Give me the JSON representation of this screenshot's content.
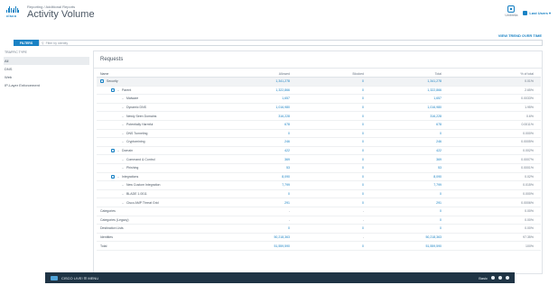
{
  "header": {
    "logo_text": "cisco",
    "breadcrumb": "Reporting / Additional Reports",
    "title": "Activity Volume",
    "shield_label": "Umbrella",
    "user_label": "Last Users ▾"
  },
  "trend_link": "VIEW TREND OVER TIME",
  "filter": {
    "button_label": "FILTERS",
    "placeholder": "Filter by identity"
  },
  "sidebar": {
    "heading": "TRAFFIC TYPE",
    "items": [
      {
        "label": "All",
        "active": true
      },
      {
        "label": "DNS",
        "active": false
      },
      {
        "label": "Web",
        "active": false
      },
      {
        "label": "IP-Layer Enforcement",
        "active": false
      }
    ]
  },
  "panel": {
    "title": "Requests"
  },
  "table": {
    "headers": {
      "name": "Name",
      "allowed": "Allowed",
      "blocked": "Blocked",
      "total": "Total",
      "pct": "% of total"
    },
    "rows": [
      {
        "name": "Security",
        "level": 0,
        "check": true,
        "allowed": "1,341,278",
        "blocked": "0",
        "total": "1,341,278",
        "pct": "0.01%",
        "group": true
      },
      {
        "name": "Parent",
        "level": 1,
        "check": true,
        "allowed": "1,322,866",
        "blocked": "0",
        "total": "1,322,866",
        "pct": "2.65%",
        "group": false
      },
      {
        "name": "Malware",
        "level": 2,
        "check": false,
        "allowed": "1,657",
        "blocked": "0",
        "total": "1,657",
        "pct": "0.0033%",
        "group": false
      },
      {
        "name": "Dynamic DNS",
        "level": 2,
        "check": false,
        "allowed": "1,016,980",
        "blocked": "0",
        "total": "1,016,980",
        "pct": "1.95%",
        "group": false
      },
      {
        "name": "Newly Seen Domains",
        "level": 2,
        "check": false,
        "allowed": "316,228",
        "blocked": "0",
        "total": "316,228",
        "pct": "0.6%",
        "group": false
      },
      {
        "name": "Potentially Harmful",
        "level": 2,
        "check": false,
        "allowed": "678",
        "blocked": "0",
        "total": "678",
        "pct": "0.0011%",
        "group": false
      },
      {
        "name": "DNS Tunneling",
        "level": 2,
        "check": false,
        "allowed": "0",
        "blocked": "0",
        "total": "0",
        "pct": "0.000%",
        "group": false
      },
      {
        "name": "Cryptomining",
        "level": 2,
        "check": false,
        "allowed": "246",
        "blocked": "0",
        "total": "246",
        "pct": "0.0005%",
        "group": false
      },
      {
        "name": "Domain",
        "level": 1,
        "check": true,
        "allowed": "422",
        "blocked": "0",
        "total": "422",
        "pct": "0.002%",
        "group": false
      },
      {
        "name": "Command & Control",
        "level": 2,
        "check": false,
        "allowed": "369",
        "blocked": "0",
        "total": "369",
        "pct": "0.0007%",
        "group": false
      },
      {
        "name": "Phishing",
        "level": 2,
        "check": false,
        "allowed": "53",
        "blocked": "0",
        "total": "53",
        "pct": "0.0001%",
        "group": false
      },
      {
        "name": "Integrations",
        "level": 1,
        "check": true,
        "allowed": "8,090",
        "blocked": "0",
        "total": "8,090",
        "pct": "0.02%",
        "group": false
      },
      {
        "name": "New Custom Integration",
        "level": 2,
        "check": false,
        "allowed": "7,799",
        "blocked": "0",
        "total": "7,799",
        "pct": "0.015%",
        "group": false
      },
      {
        "name": "BLADE 1.0011",
        "level": 2,
        "check": false,
        "allowed": "0",
        "blocked": "0",
        "total": "0",
        "pct": "0.000%",
        "group": false
      },
      {
        "name": "Cisco AMP Threat Grid",
        "level": 2,
        "check": false,
        "allowed": "291",
        "blocked": "0",
        "total": "291",
        "pct": "0.0006%",
        "group": false
      },
      {
        "name": "Categories",
        "level": 0,
        "check": false,
        "allowed": "-",
        "blocked": "-",
        "total": "0",
        "pct": "0.00%",
        "group": false
      },
      {
        "name": "Categories (Legacy)",
        "level": 0,
        "check": false,
        "allowed": "-",
        "blocked": "-",
        "total": "0",
        "pct": "0.00%",
        "group": false
      },
      {
        "name": "Destination Lists",
        "level": 0,
        "check": false,
        "allowed": "0",
        "blocked": "0",
        "total": "0",
        "pct": "0.00%",
        "group": false
      },
      {
        "name": "Identities",
        "level": 0,
        "check": false,
        "allowed": "50,218,363",
        "blocked": "-",
        "total": "50,218,363",
        "pct": "97.35%",
        "group": false
      },
      {
        "name": "Total",
        "level": 0,
        "check": false,
        "allowed": "51,559,590",
        "blocked": "0",
        "total": "51,559,590",
        "pct": "100%",
        "group": false
      }
    ]
  },
  "taskbar": {
    "left_label": "CISCO LIVE!  ☰ MENU",
    "right_label": "Basic"
  },
  "colors": {
    "accent": "#1a82c4",
    "taskbar": "#1f3445"
  }
}
